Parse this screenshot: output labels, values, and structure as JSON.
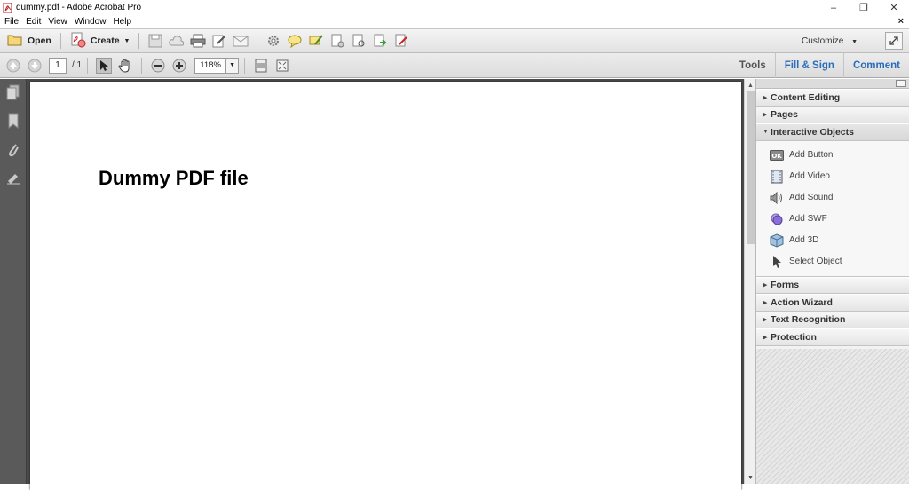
{
  "window": {
    "title": "dummy.pdf - Adobe Acrobat Pro",
    "minimize": "–",
    "restore": "❐",
    "close": "✕"
  },
  "menu": {
    "items": [
      "File",
      "Edit",
      "View",
      "Window",
      "Help"
    ],
    "close_doc": "×"
  },
  "toolbar": {
    "open_label": "Open",
    "create_label": "Create",
    "customize_label": "Customize"
  },
  "nav": {
    "current_page": "1",
    "page_count": "/ 1",
    "zoom": "118%"
  },
  "tabs": {
    "tools": "Tools",
    "fill_sign": "Fill & Sign",
    "comment": "Comment"
  },
  "document": {
    "heading": "Dummy PDF file"
  },
  "panel": {
    "sections_top": [
      "Content Editing",
      "Pages"
    ],
    "open_section": "Interactive Objects",
    "open_items": [
      {
        "label": "Add Button",
        "icon": "button-icon"
      },
      {
        "label": "Add Video",
        "icon": "video-icon"
      },
      {
        "label": "Add Sound",
        "icon": "sound-icon"
      },
      {
        "label": "Add SWF",
        "icon": "swf-icon"
      },
      {
        "label": "Add 3D",
        "icon": "cube-icon"
      },
      {
        "label": "Select Object",
        "icon": "select-arrow-icon"
      }
    ],
    "sections_bottom": [
      "Forms",
      "Action Wizard",
      "Text Recognition",
      "Protection"
    ]
  },
  "colors": {
    "accent_blue": "#2a6ebb",
    "nav_dark": "#5a5a5a"
  }
}
